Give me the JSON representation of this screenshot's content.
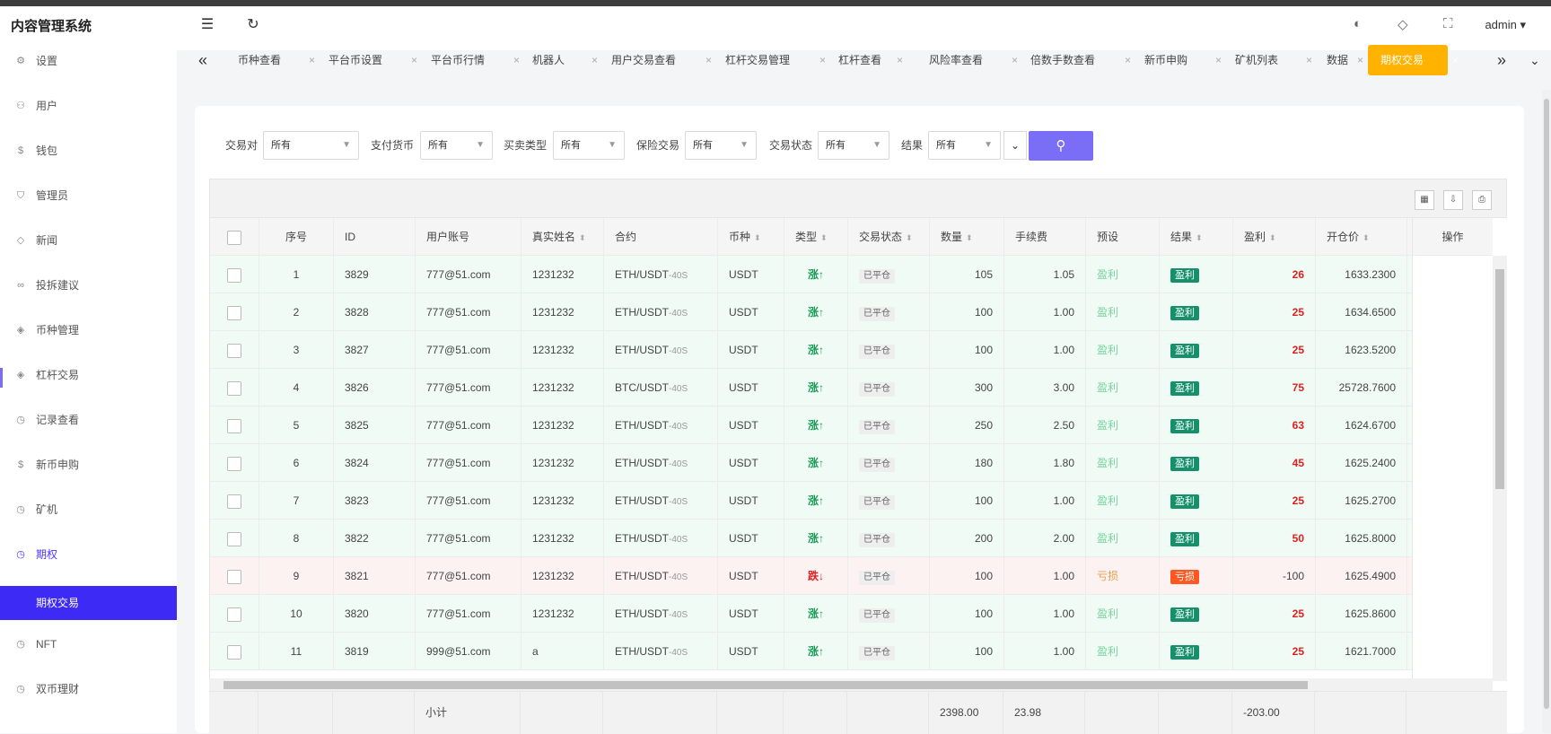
{
  "app": {
    "title": "内容管理系统",
    "user": "admin"
  },
  "topbar": {
    "menu_icon": "menu-fold-icon",
    "refresh_icon": "refresh-icon"
  },
  "sidebar": {
    "items": [
      {
        "label": "设置",
        "icon": "gear-icon"
      },
      {
        "label": "用户",
        "icon": "user-icon"
      },
      {
        "label": "钱包",
        "icon": "dollar-icon"
      },
      {
        "label": "管理员",
        "icon": "shield-icon"
      },
      {
        "label": "新闻",
        "icon": "tag-icon"
      },
      {
        "label": "投拆建议",
        "icon": "link-icon"
      },
      {
        "label": "币种管理",
        "icon": "diamond-icon"
      },
      {
        "label": "杠杆交易",
        "icon": "diamond-icon"
      },
      {
        "label": "记录查看",
        "icon": "clock-icon"
      },
      {
        "label": "新币申购",
        "icon": "dollar-icon"
      },
      {
        "label": "矿机",
        "icon": "clock-icon"
      },
      {
        "label": "期权",
        "icon": "clock-icon"
      },
      {
        "label": "NFT",
        "icon": "clock-icon"
      },
      {
        "label": "双币理财",
        "icon": "clock-icon"
      }
    ],
    "active_sub": "期权交易"
  },
  "tabs": [
    "币种查看",
    "平台币设置",
    "平台币行情",
    "机器人",
    "用户交易查看",
    "杠杆交易管理",
    "杠杆查看",
    "风险率查看",
    "倍数手数查看",
    "新币申购",
    "矿机列表",
    "数据",
    "期权交易"
  ],
  "filters": {
    "labels": [
      "交易对",
      "支付货币",
      "买卖类型",
      "保险交易",
      "交易状态",
      "结果"
    ],
    "value": "所有"
  },
  "table": {
    "headers": [
      "序号",
      "ID",
      "用户账号",
      "真实姓名",
      "合约",
      "币种",
      "类型",
      "交易状态",
      "数量",
      "手续费",
      "预设",
      "结果",
      "盈利",
      "开仓价",
      "操作"
    ],
    "rows": [
      {
        "no": "1",
        "id": "3829",
        "account": "777@51.com",
        "name": "1231232",
        "pair": "ETH/USDT",
        "suffix": "-40S",
        "coin": "USDT",
        "type": "涨↑",
        "status": "已平仓",
        "qty": "105",
        "fee": "1.05",
        "preset": "盈利",
        "result": "盈利",
        "pnl": "26",
        "open": "1633.2300",
        "win": true
      },
      {
        "no": "2",
        "id": "3828",
        "account": "777@51.com",
        "name": "1231232",
        "pair": "ETH/USDT",
        "suffix": "-40S",
        "coin": "USDT",
        "type": "涨↑",
        "status": "已平仓",
        "qty": "100",
        "fee": "1.00",
        "preset": "盈利",
        "result": "盈利",
        "pnl": "25",
        "open": "1634.6500",
        "win": true
      },
      {
        "no": "3",
        "id": "3827",
        "account": "777@51.com",
        "name": "1231232",
        "pair": "ETH/USDT",
        "suffix": "-40S",
        "coin": "USDT",
        "type": "涨↑",
        "status": "已平仓",
        "qty": "100",
        "fee": "1.00",
        "preset": "盈利",
        "result": "盈利",
        "pnl": "25",
        "open": "1623.5200",
        "win": true
      },
      {
        "no": "4",
        "id": "3826",
        "account": "777@51.com",
        "name": "1231232",
        "pair": "BTC/USDT",
        "suffix": "-40S",
        "coin": "USDT",
        "type": "涨↑",
        "status": "已平仓",
        "qty": "300",
        "fee": "3.00",
        "preset": "盈利",
        "result": "盈利",
        "pnl": "75",
        "open": "25728.7600",
        "win": true
      },
      {
        "no": "5",
        "id": "3825",
        "account": "777@51.com",
        "name": "1231232",
        "pair": "ETH/USDT",
        "suffix": "-40S",
        "coin": "USDT",
        "type": "涨↑",
        "status": "已平仓",
        "qty": "250",
        "fee": "2.50",
        "preset": "盈利",
        "result": "盈利",
        "pnl": "63",
        "open": "1624.6700",
        "win": true
      },
      {
        "no": "6",
        "id": "3824",
        "account": "777@51.com",
        "name": "1231232",
        "pair": "ETH/USDT",
        "suffix": "-40S",
        "coin": "USDT",
        "type": "涨↑",
        "status": "已平仓",
        "qty": "180",
        "fee": "1.80",
        "preset": "盈利",
        "result": "盈利",
        "pnl": "45",
        "open": "1625.2400",
        "win": true
      },
      {
        "no": "7",
        "id": "3823",
        "account": "777@51.com",
        "name": "1231232",
        "pair": "ETH/USDT",
        "suffix": "-40S",
        "coin": "USDT",
        "type": "涨↑",
        "status": "已平仓",
        "qty": "100",
        "fee": "1.00",
        "preset": "盈利",
        "result": "盈利",
        "pnl": "25",
        "open": "1625.2700",
        "win": true
      },
      {
        "no": "8",
        "id": "3822",
        "account": "777@51.com",
        "name": "1231232",
        "pair": "ETH/USDT",
        "suffix": "-40S",
        "coin": "USDT",
        "type": "涨↑",
        "status": "已平仓",
        "qty": "200",
        "fee": "2.00",
        "preset": "盈利",
        "result": "盈利",
        "pnl": "50",
        "open": "1625.8000",
        "win": true
      },
      {
        "no": "9",
        "id": "3821",
        "account": "777@51.com",
        "name": "1231232",
        "pair": "ETH/USDT",
        "suffix": "-40S",
        "coin": "USDT",
        "type": "跌↓",
        "status": "已平仓",
        "qty": "100",
        "fee": "1.00",
        "preset": "亏损",
        "result": "亏损",
        "pnl": "-100",
        "open": "1625.4900",
        "win": false
      },
      {
        "no": "10",
        "id": "3820",
        "account": "777@51.com",
        "name": "1231232",
        "pair": "ETH/USDT",
        "suffix": "-40S",
        "coin": "USDT",
        "type": "涨↑",
        "status": "已平仓",
        "qty": "100",
        "fee": "1.00",
        "preset": "盈利",
        "result": "盈利",
        "pnl": "25",
        "open": "1625.8600",
        "win": true
      },
      {
        "no": "11",
        "id": "3819",
        "account": "999@51.com",
        "name": "a",
        "pair": "ETH/USDT",
        "suffix": "-40S",
        "coin": "USDT",
        "type": "涨↑",
        "status": "已平仓",
        "qty": "100",
        "fee": "1.00",
        "preset": "盈利",
        "result": "盈利",
        "pnl": "25",
        "open": "1621.7000",
        "win": true
      }
    ]
  },
  "totals": {
    "label": "小计",
    "qty": "2398.00",
    "fee": "23.98",
    "pnl": "-203.00"
  },
  "colors": {
    "accent": "#4b37ff",
    "active_tab": "#ffb300",
    "win_tag": "#15906a",
    "lose_tag": "#ff5722",
    "search_btn": "#7b6ef6"
  }
}
